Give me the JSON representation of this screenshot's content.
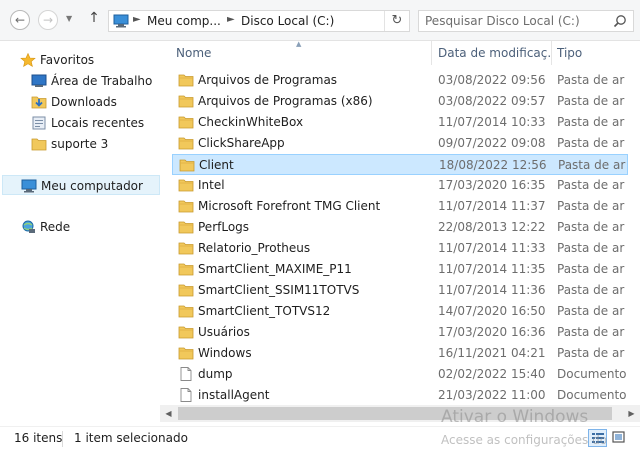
{
  "address": {
    "crumbs": [
      "Meu comp...",
      "Disco Local (C:)"
    ],
    "search_placeholder": "Pesquisar Disco Local (C:)"
  },
  "nav": {
    "favorites_label": "Favoritos",
    "favorites": [
      {
        "label": "Área de Trabalho",
        "icon": "desktop-icon"
      },
      {
        "label": "Downloads",
        "icon": "downloads-icon"
      },
      {
        "label": "Locais recentes",
        "icon": "recent-places-icon"
      },
      {
        "label": "suporte 3",
        "icon": "folder-icon"
      }
    ],
    "computer_label": "Meu computador",
    "network_label": "Rede"
  },
  "columns": {
    "name": "Nome",
    "date": "Data de modificaç...",
    "type": "Tipo"
  },
  "files": [
    {
      "name": "Arquivos de Programas",
      "date": "03/08/2022 09:56",
      "type": "Pasta de ar",
      "kind": "folder"
    },
    {
      "name": "Arquivos de Programas (x86)",
      "date": "03/08/2022 09:57",
      "type": "Pasta de ar",
      "kind": "folder"
    },
    {
      "name": "CheckinWhiteBox",
      "date": "11/07/2014 10:33",
      "type": "Pasta de ar",
      "kind": "folder"
    },
    {
      "name": "ClickShareApp",
      "date": "09/07/2022 09:08",
      "type": "Pasta de ar",
      "kind": "folder"
    },
    {
      "name": "Client",
      "date": "18/08/2022 12:56",
      "type": "Pasta de ar",
      "kind": "folder",
      "selected": true
    },
    {
      "name": "Intel",
      "date": "17/03/2020 16:35",
      "type": "Pasta de ar",
      "kind": "folder"
    },
    {
      "name": "Microsoft Forefront TMG Client",
      "date": "11/07/2014 11:37",
      "type": "Pasta de ar",
      "kind": "folder"
    },
    {
      "name": "PerfLogs",
      "date": "22/08/2013 12:22",
      "type": "Pasta de ar",
      "kind": "folder"
    },
    {
      "name": "Relatorio_Protheus",
      "date": "11/07/2014 11:33",
      "type": "Pasta de ar",
      "kind": "folder"
    },
    {
      "name": "SmartClient_MAXIME_P11",
      "date": "11/07/2014 11:35",
      "type": "Pasta de ar",
      "kind": "folder"
    },
    {
      "name": "SmartClient_SSIM11TOTVS",
      "date": "11/07/2014 11:36",
      "type": "Pasta de ar",
      "kind": "folder"
    },
    {
      "name": "SmartClient_TOTVS12",
      "date": "14/07/2020 16:50",
      "type": "Pasta de ar",
      "kind": "folder"
    },
    {
      "name": "Usuários",
      "date": "17/03/2020 16:36",
      "type": "Pasta de ar",
      "kind": "folder"
    },
    {
      "name": "Windows",
      "date": "16/11/2021 04:21",
      "type": "Pasta de ar",
      "kind": "folder"
    },
    {
      "name": "dump",
      "date": "02/02/2022 15:40",
      "type": "Documento",
      "kind": "file"
    },
    {
      "name": "installAgent",
      "date": "21/03/2022 11:00",
      "type": "Documento",
      "kind": "file"
    }
  ],
  "status": {
    "count": "16 itens",
    "selection": "1 item selecionado"
  },
  "watermark": {
    "line1": "Ativar o Windows",
    "line2": "Acesse as configurações do"
  },
  "colors": {
    "selection_bg": "#cce8ff",
    "selection_border": "#99d1ff",
    "header_text": "#4c607a",
    "folder": "#f1c85b"
  }
}
